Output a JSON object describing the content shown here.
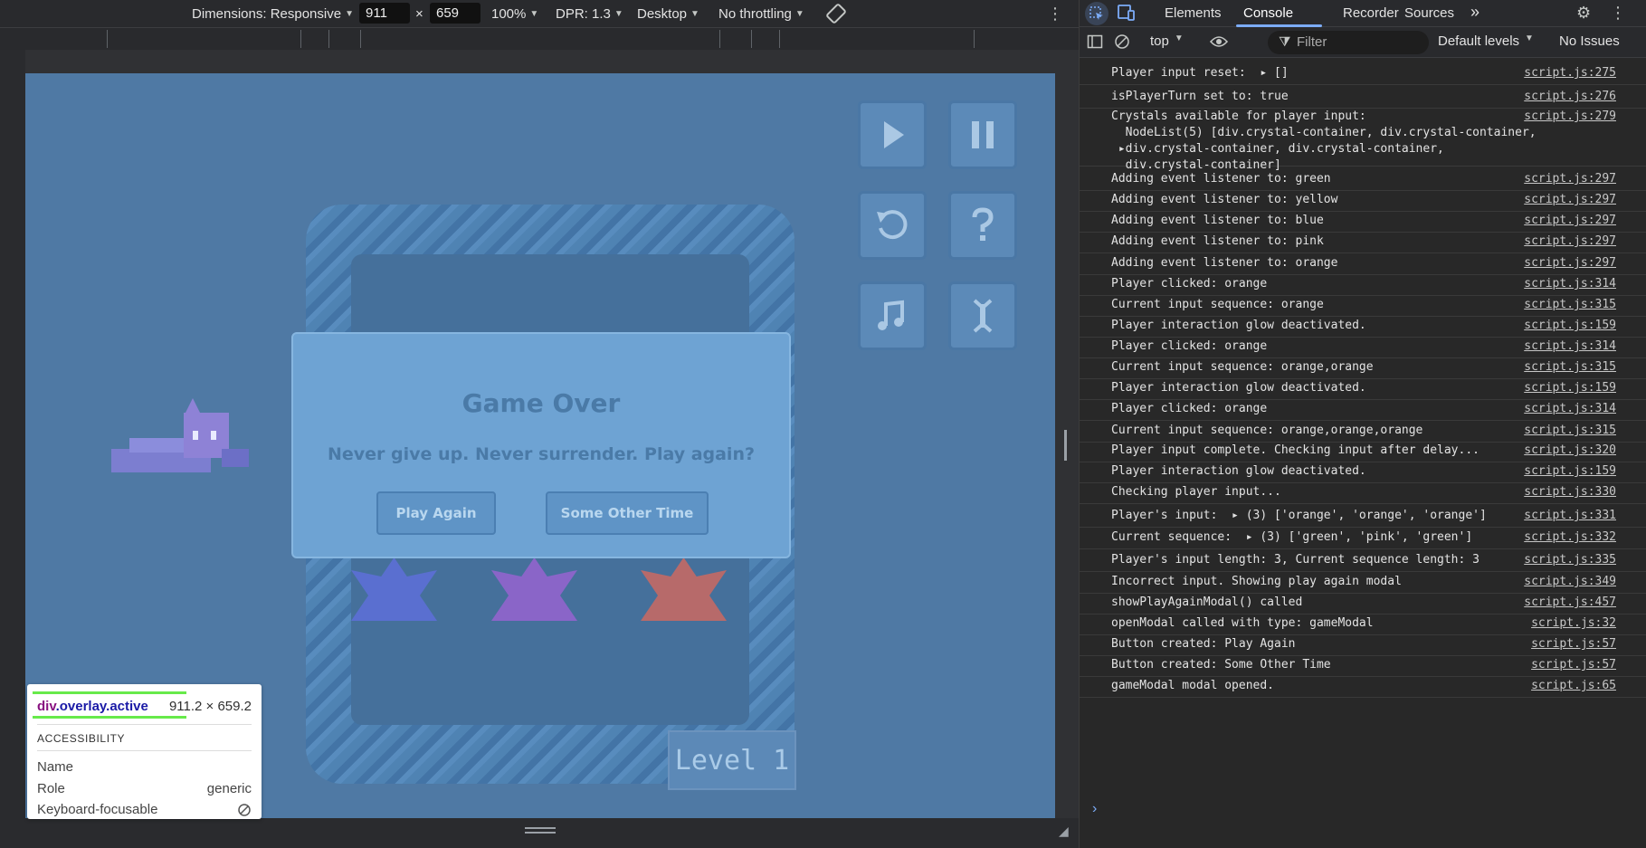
{
  "devbar": {
    "dimensions_label": "Dimensions: Responsive",
    "width": "911",
    "times": "×",
    "height": "659",
    "zoom": "100%",
    "dpr": "DPR: 1.3",
    "device": "Desktop",
    "throttling": "No throttling"
  },
  "game": {
    "modal_title": "Game Over",
    "modal_text": "Never give up. Never surrender. Play again?",
    "play_again": "Play Again",
    "other_time": "Some Other Time",
    "level": "Level 1"
  },
  "tooltip": {
    "tag": "div",
    "class": ".overlay.active",
    "size": "911.2 × 659.2",
    "section": "ACCESSIBILITY",
    "name_label": "Name",
    "role_label": "Role",
    "role_value": "generic",
    "focus_label": "Keyboard-focusable"
  },
  "devtools": {
    "tabs": [
      "Elements",
      "Console",
      "Recorder",
      "Sources"
    ],
    "more": "»",
    "context": "top",
    "filter_placeholder": "Filter",
    "levels": "Default levels",
    "issues": "No Issues"
  },
  "console": [
    {
      "msg": "Player input reset:  ▸ []",
      "src": "script.js:275"
    },
    {
      "msg": "isPlayerTurn set to: true",
      "src": "script.js:276"
    },
    {
      "msg": "Crystals available for player input:\n  NodeList(5) [div.crystal-container, div.crystal-container,\n ▸div.crystal-container, div.crystal-container,\n  div.crystal-container]",
      "src": "script.js:279"
    },
    {
      "msg": "Adding event listener to: green",
      "src": "script.js:297"
    },
    {
      "msg": "Adding event listener to: yellow",
      "src": "script.js:297"
    },
    {
      "msg": "Adding event listener to: blue",
      "src": "script.js:297"
    },
    {
      "msg": "Adding event listener to: pink",
      "src": "script.js:297"
    },
    {
      "msg": "Adding event listener to: orange",
      "src": "script.js:297"
    },
    {
      "msg": "Player clicked: orange",
      "src": "script.js:314"
    },
    {
      "msg": "Current input sequence: orange",
      "src": "script.js:315"
    },
    {
      "msg": "Player interaction glow deactivated.",
      "src": "script.js:159"
    },
    {
      "msg": "Player clicked: orange",
      "src": "script.js:314"
    },
    {
      "msg": "Current input sequence: orange,orange",
      "src": "script.js:315"
    },
    {
      "msg": "Player interaction glow deactivated.",
      "src": "script.js:159"
    },
    {
      "msg": "Player clicked: orange",
      "src": "script.js:314"
    },
    {
      "msg": "Current input sequence: orange,orange,orange",
      "src": "script.js:315"
    },
    {
      "msg": "Player input complete. Checking input after delay...",
      "src": "script.js:320"
    },
    {
      "msg": "Player interaction glow deactivated.",
      "src": "script.js:159"
    },
    {
      "msg": "Checking player input...",
      "src": "script.js:330"
    },
    {
      "msg": "Player's input:  ▸ (3) ['orange', 'orange', 'orange']",
      "src": "script.js:331"
    },
    {
      "msg": "Current sequence:  ▸ (3) ['green', 'pink', 'green']",
      "src": "script.js:332"
    },
    {
      "msg": "Player's input length: 3, Current sequence length: 3",
      "src": "script.js:335"
    },
    {
      "msg": "Incorrect input. Showing play again modal",
      "src": "script.js:349"
    },
    {
      "msg": "showPlayAgainModal() called",
      "src": "script.js:457"
    },
    {
      "msg": "openModal called with type: gameModal",
      "src": "script.js:32"
    },
    {
      "msg": "Button created: Play Again",
      "src": "script.js:57"
    },
    {
      "msg": "Button created: Some Other Time",
      "src": "script.js:57"
    },
    {
      "msg": "gameModal modal opened.",
      "src": "script.js:65"
    }
  ],
  "colors": {
    "game_bg": "#4f79a4",
    "devtools_bg": "#282828",
    "accent": "#7cacf8"
  }
}
